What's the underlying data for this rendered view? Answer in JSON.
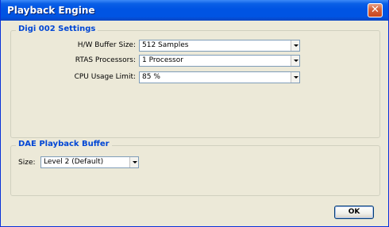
{
  "window": {
    "title": "Playback Engine",
    "close_glyph": "✕"
  },
  "digi_settings": {
    "title": "Digi 002 Settings",
    "fields": [
      {
        "label": "H/W Buffer Size:",
        "value": "512 Samples"
      },
      {
        "label": "RTAS Processors:",
        "value": "1 Processor"
      },
      {
        "label": "CPU Usage Limit:",
        "value": "85 %"
      }
    ]
  },
  "dae_buffer": {
    "title": "DAE Playback Buffer",
    "size_label": "Size:",
    "size_value": "Level 2 (Default)"
  },
  "buttons": {
    "ok_label": "OK"
  },
  "colors": {
    "titlebar": "#0054e3",
    "dialog_bg": "#ece9d8",
    "group_title": "#0046d5",
    "close_button": "#c8461f"
  },
  "icons": {
    "close": "close-icon",
    "dropdown": "chevron-down-icon"
  }
}
